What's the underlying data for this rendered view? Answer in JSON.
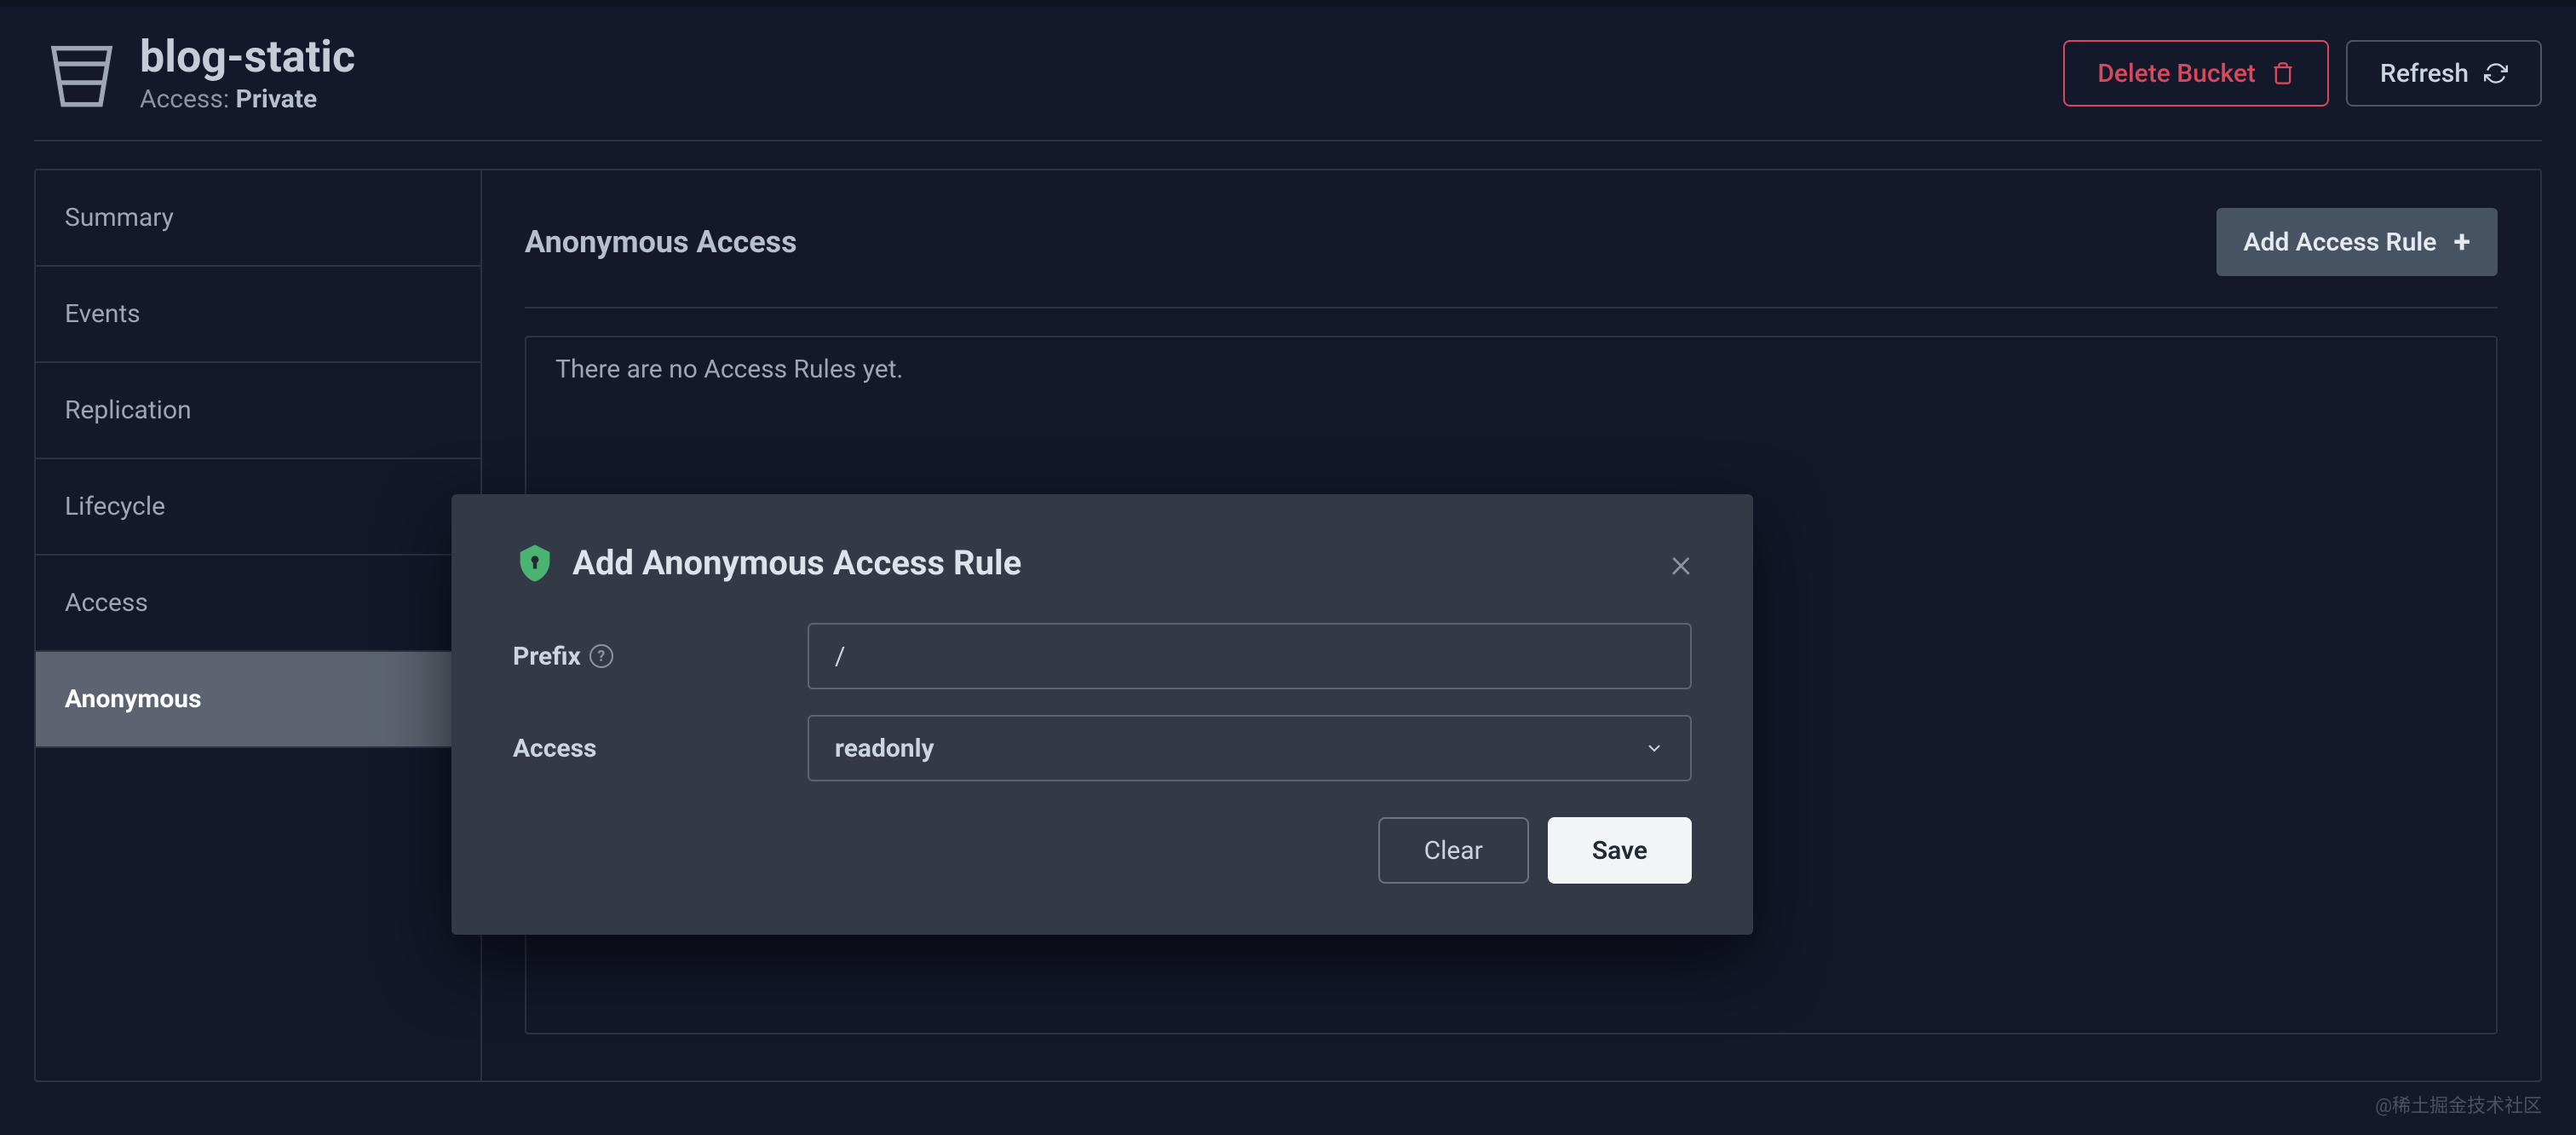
{
  "header": {
    "bucket_name": "blog-static",
    "access_label": "Access:",
    "access_value": "Private",
    "delete_label": "Delete Bucket",
    "refresh_label": "Refresh"
  },
  "sidebar": {
    "items": [
      {
        "label": "Summary"
      },
      {
        "label": "Events"
      },
      {
        "label": "Replication"
      },
      {
        "label": "Lifecycle"
      },
      {
        "label": "Access"
      },
      {
        "label": "Anonymous"
      }
    ]
  },
  "content": {
    "title": "Anonymous Access",
    "add_button": "Add Access Rule",
    "empty_message": "There are no Access Rules yet."
  },
  "modal": {
    "title": "Add Anonymous Access Rule",
    "prefix_label": "Prefix",
    "prefix_value": "/",
    "access_label": "Access",
    "access_value": "readonly",
    "clear_label": "Clear",
    "save_label": "Save"
  },
  "watermark": "@稀土掘金技术社区"
}
